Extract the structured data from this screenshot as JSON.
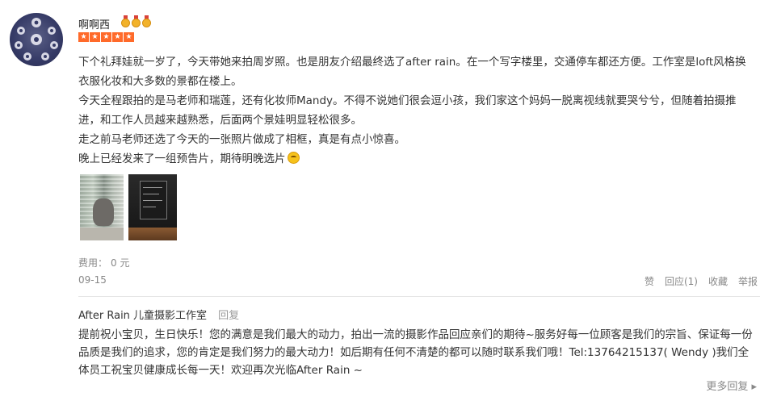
{
  "user": {
    "name": "啊啊西",
    "medal_count": 3,
    "rating_stars": 5
  },
  "review": {
    "paragraphs": [
      "下个礼拜娃就一岁了，今天带她来拍周岁照。也是朋友介绍最终选了after rain。在一个写字楼里，交通停车都还方便。工作室是loft风格换衣服化妆和大多数的景都在楼上。",
      "今天全程跟拍的是马老师和瑞莲，还有化妆师Mandy。不得不说她们很会逗小孩，我们家这个妈妈一脱离视线就要哭兮兮，但随着拍摄推进，和工作人员越来越熟悉，后面两个景娃明显轻松很多。",
      "走之前马老师还选了今天的一张照片做成了相框，真是有点小惊喜。",
      "晚上已经发来了一组预告片，期待明晚选片"
    ],
    "emoji": "smile-emoji"
  },
  "fee": {
    "label": "费用：",
    "value": "0 元"
  },
  "meta": {
    "date": "09-15"
  },
  "actions": {
    "like": "赞",
    "reply": "回应(1)",
    "favorite": "收藏",
    "report": "举报"
  },
  "merchant_reply": {
    "name": "After Rain 儿童摄影工作室",
    "reply_label": "回复",
    "text": "提前祝小宝贝，生日快乐！您的满意是我们最大的动力，拍出一流的摄影作品回应亲们的期待~服务好每一位顾客是我们的宗旨、保证每一份品质是我们的追求，您的肯定是我们努力的最大动力！如后期有任何不清楚的都可以随时联系我们哦！Tel:13764215137( Wendy )我们全体员工祝宝贝健康成长每一天！欢迎再次光临After Rain ~"
  },
  "more_replies": "更多回复 ▸",
  "colors": {
    "star": "#ff6a2a",
    "medal": "#f2b22b",
    "avatar": "#353a66",
    "muted_text": "#888888"
  }
}
